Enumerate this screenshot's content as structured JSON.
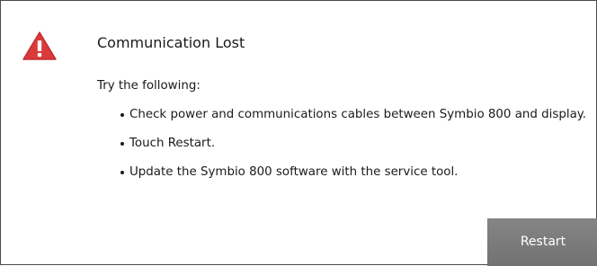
{
  "dialog": {
    "icon": "warning-icon",
    "title": "Communication Lost",
    "intro": "Try the following:",
    "steps": [
      "Check power and communications cables between Symbio 800 and display.",
      "Touch Restart.",
      "Update the Symbio 800 software with the service tool."
    ],
    "restart_label": "Restart"
  },
  "colors": {
    "warning": "#d93a3a",
    "button": "#7a7a7a",
    "border": "#4a4a4a"
  }
}
